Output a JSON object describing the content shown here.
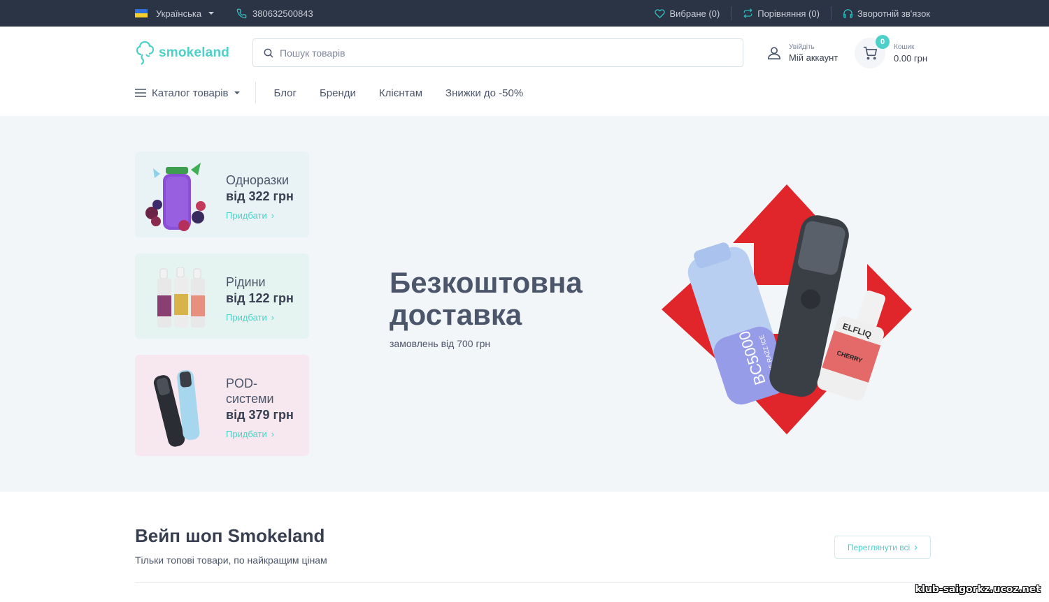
{
  "topbar": {
    "language": "Українська",
    "phone": "380632500843",
    "wishlist": "Вибране (0)",
    "compare": "Порівняння (0)",
    "feedback": "Зворотній зв'язок"
  },
  "header": {
    "logo": "smokeland",
    "search_placeholder": "Пошук товарів",
    "account_small": "Увійдіть",
    "account_big": "Мій аккаунт",
    "cart_count": "0",
    "cart_small": "Кошик",
    "cart_total": "0.00 грн"
  },
  "nav": {
    "catalog": "Каталог товарів",
    "items": [
      "Блог",
      "Бренди",
      "Клієнтам",
      "Знижки до -50%"
    ]
  },
  "cards": [
    {
      "name": "Одноразки",
      "price": "від 322 грн",
      "buy": "Придбати",
      "bg": "#e9f3f6"
    },
    {
      "name": "Рідини",
      "price": "від 122 грн",
      "buy": "Придбати",
      "bg": "#e6f4f1"
    },
    {
      "name": "POD-\nсистеми",
      "name_l1": "POD-",
      "name_l2": "системи",
      "price": "від 379 грн",
      "buy": "Придбати",
      "bg": "#f6e8ee"
    }
  ],
  "promo": {
    "title_l1": "Безкоштовна",
    "title_l2": "доставка",
    "subtitle": "замовлень від 700 грн",
    "brand_red": "#e0262b",
    "device_labels": [
      "BC5000",
      "BLUE RAZZ ICE",
      "ELFLIQ",
      "CHERRY"
    ]
  },
  "section": {
    "title": "Вейп шоп Smokeland",
    "subtitle": "Тільки топові товари, по найкращим цінам",
    "view_all": "Переглянути всі"
  },
  "watermark": "klub-saigorkz.ucoz.net",
  "colors": {
    "accent": "#4dd0c8",
    "topbar": "#2b3445",
    "hero_bg": "#f3f6f9"
  }
}
